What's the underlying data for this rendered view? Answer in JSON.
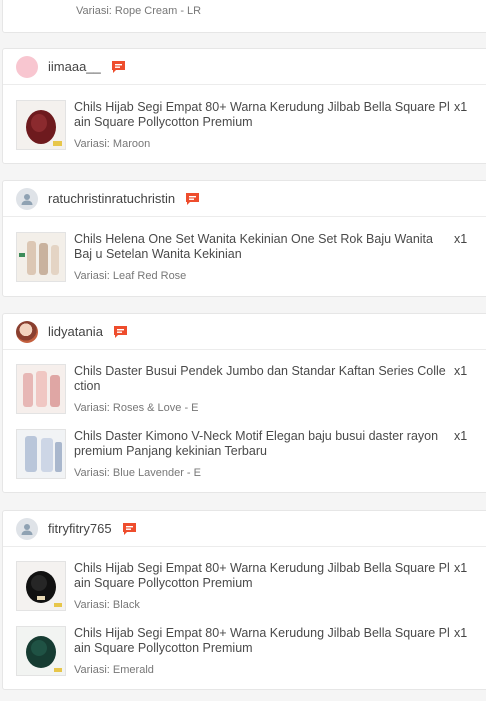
{
  "top_item": {
    "variant": "Variasi: Rope Cream - LR"
  },
  "orders": [
    {
      "username": "iimaaa__",
      "avatar": "pink",
      "items": [
        {
          "title": "Chils Hijab Segi Empat 80+ Warna Kerudung Jilbab Bella Square Pl ain Square Pollycotton Premium",
          "variant": "Variasi: Maroon",
          "qty": "x1",
          "thumb": "maroon"
        }
      ]
    },
    {
      "username": "ratuchristinratuchristin",
      "avatar": "grey",
      "items": [
        {
          "title": "Chils Helena One Set Wanita Kekinian One Set Rok Baju Wanita Baj u Setelan Wanita Kekinian",
          "variant": "Variasi: Leaf Red Rose",
          "qty": "x1",
          "thumb": "beige"
        }
      ]
    },
    {
      "username": "lidyatania",
      "avatar": "photo",
      "items": [
        {
          "title": "Chils Daster Busui Pendek Jumbo dan Standar Kaftan Series Colle ction",
          "variant": "Variasi: Roses & Love - E",
          "qty": "x1",
          "thumb": "pink"
        },
        {
          "title": "Chils Daster Kimono V-Neck Motif Elegan baju busui daster rayon premium Panjang kekinian Terbaru",
          "variant": "Variasi: Blue Lavender - E",
          "qty": "x1",
          "thumb": "blue"
        }
      ]
    },
    {
      "username": "fitryfitry765",
      "avatar": "grey",
      "items": [
        {
          "title": "Chils Hijab Segi Empat 80+ Warna Kerudung Jilbab Bella Square Pl ain Square Pollycotton Premium",
          "variant": "Variasi: Black",
          "qty": "x1",
          "thumb": "black"
        },
        {
          "title": "Chils Hijab Segi Empat 80+ Warna Kerudung Jilbab Bella Square Pl ain Square Pollycotton Premium",
          "variant": "Variasi: Emerald",
          "qty": "x1",
          "thumb": "emerald"
        }
      ]
    }
  ],
  "colors": {
    "chat_accent": "#ee4d2d"
  }
}
